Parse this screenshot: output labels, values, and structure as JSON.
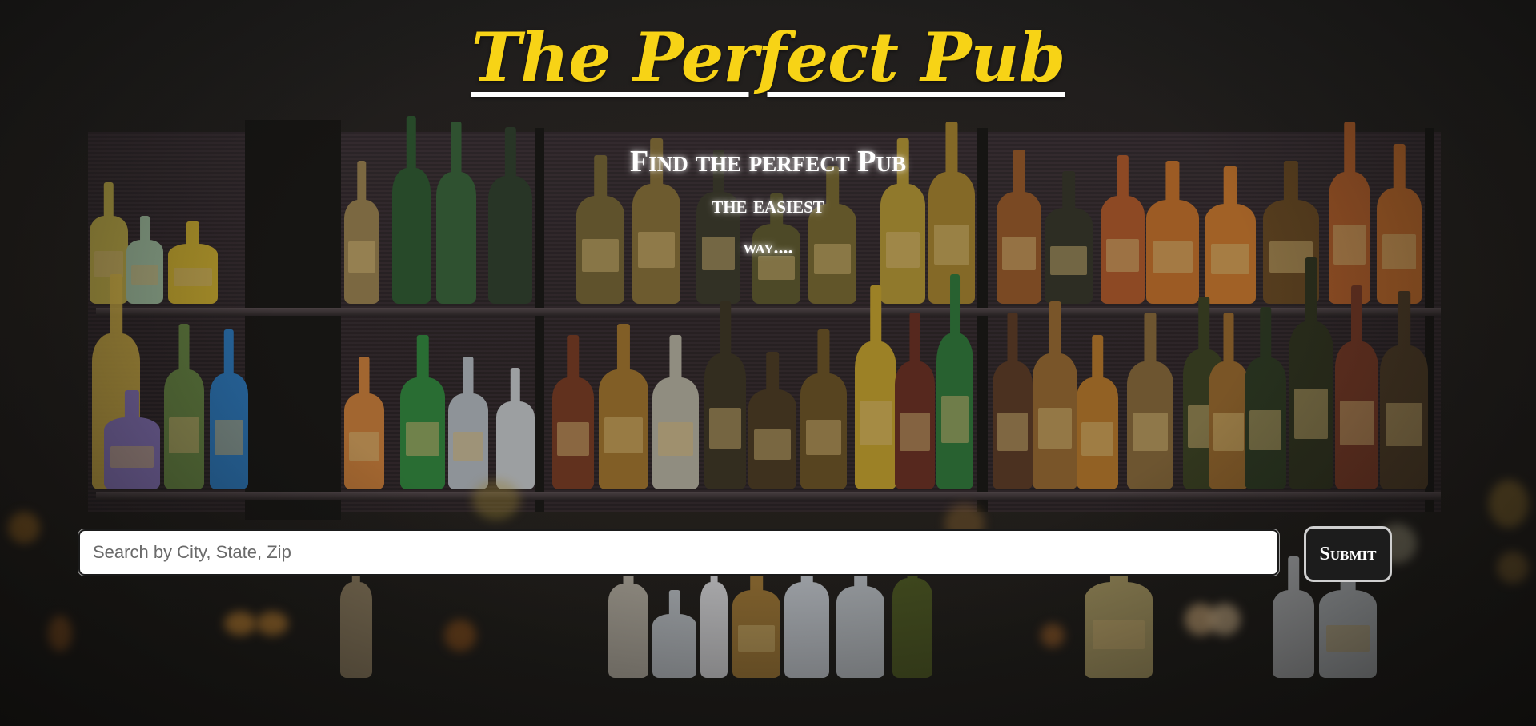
{
  "header": {
    "title": "The Perfect Pub"
  },
  "tagline": {
    "line1": "Find the perfect Pub",
    "line2": "the easiest",
    "line3": "way...."
  },
  "search": {
    "placeholder": "Search by City, State, Zip",
    "value": "",
    "submit_label": "Submit"
  },
  "colors": {
    "title": "#f7d316",
    "title_underline": "#ffffff",
    "background": "#1f1d1b",
    "button_bg": "#1c1c1c"
  }
}
